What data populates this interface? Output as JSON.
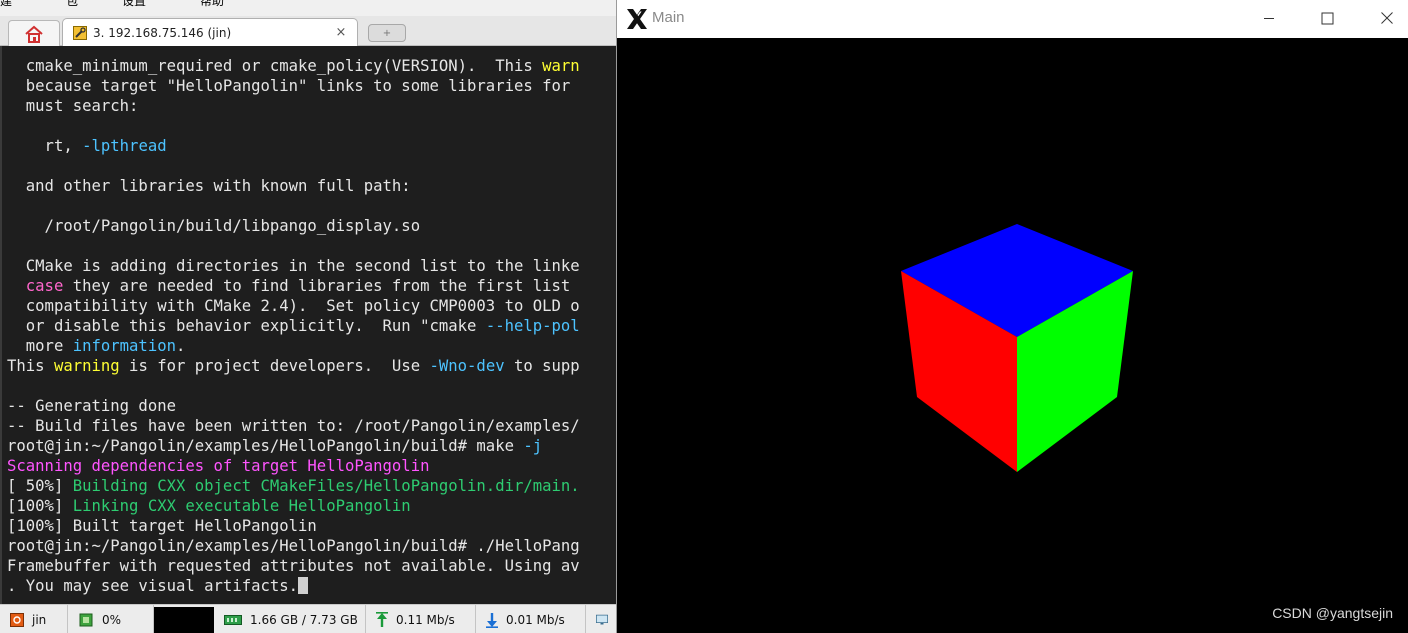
{
  "menu": {
    "items": [
      "建",
      "包",
      "设置",
      "帮助"
    ]
  },
  "tabs": {
    "home_icon": "home-icon",
    "session_title": "3. 192.168.75.146 (jin)",
    "close_glyph": "×",
    "new_tab_glyph": "+"
  },
  "terminal": {
    "lines": [
      [
        {
          "t": "  cmake_minimum_required or cmake_policy(VERSION).  This "
        },
        {
          "t": "warn",
          "c": "yel"
        }
      ],
      [
        {
          "t": "  because target \"HelloPangolin\" links to some libraries for"
        }
      ],
      [
        {
          "t": "  must search:"
        }
      ],
      [
        {
          "t": ""
        }
      ],
      [
        {
          "t": "    rt, "
        },
        {
          "t": "-lpthread",
          "c": "cyn"
        }
      ],
      [
        {
          "t": ""
        }
      ],
      [
        {
          "t": "  and other libraries with known full path:"
        }
      ],
      [
        {
          "t": ""
        }
      ],
      [
        {
          "t": "    /root/Pangolin/build/libpango_display.so"
        }
      ],
      [
        {
          "t": ""
        }
      ],
      [
        {
          "t": "  CMake is adding directories in the second list to the linke"
        }
      ],
      [
        {
          "t": "  "
        },
        {
          "t": "case",
          "c": "pnk"
        },
        {
          "t": " they are needed to find libraries from the first list"
        }
      ],
      [
        {
          "t": "  compatibility with CMake 2.4).  Set policy CMP0003 to OLD o"
        }
      ],
      [
        {
          "t": "  or disable this behavior explicitly.  Run \"cmake "
        },
        {
          "t": "--help-pol",
          "c": "cyn"
        }
      ],
      [
        {
          "t": "  more "
        },
        {
          "t": "information",
          "c": "cyn"
        },
        {
          "t": "."
        }
      ],
      [
        {
          "t": "This "
        },
        {
          "t": "warning",
          "c": "yel"
        },
        {
          "t": " is for project developers.  Use "
        },
        {
          "t": "-Wno-dev",
          "c": "cyn"
        },
        {
          "t": " to supp"
        }
      ],
      [
        {
          "t": ""
        }
      ],
      [
        {
          "t": "-- Generating done"
        }
      ],
      [
        {
          "t": "-- Build files have been written to: /root/Pangolin/examples/"
        }
      ],
      [
        {
          "t": "root@jin:~/Pangolin/examples/HelloPangolin/build# make "
        },
        {
          "t": "-j",
          "c": "cyn"
        }
      ],
      [
        {
          "t": "Scanning dependencies of target HelloPangolin",
          "c": "mag"
        }
      ],
      [
        {
          "t": "[ 50%] "
        },
        {
          "t": "Building CXX object CMakeFiles/HelloPangolin.dir/main.",
          "c": "grn"
        }
      ],
      [
        {
          "t": "[100%] "
        },
        {
          "t": "Linking CXX executable HelloPangolin",
          "c": "grn"
        }
      ],
      [
        {
          "t": "[100%] Built target HelloPangolin"
        }
      ],
      [
        {
          "t": "root@jin:~/Pangolin/examples/HelloPangolin/build# ./HelloPang"
        }
      ],
      [
        {
          "t": "Framebuffer with requested attributes not available. Using av"
        }
      ],
      [
        {
          "t": ". You may see visual artifacts."
        },
        {
          "cursor": true
        }
      ]
    ]
  },
  "status_bar": {
    "user": "jin",
    "cpu": "0%",
    "memory": "1.66 GB / 7.73 GB",
    "upload": "0.11 Mb/s",
    "download": "0.01 Mb/s"
  },
  "viewer": {
    "title": "Main",
    "app_icon": "x11-logo-icon",
    "minimize_icon": "minimize-icon",
    "maximize_icon": "maximize-icon",
    "close_icon": "close-icon",
    "cube_faces": {
      "top": "#0000ff",
      "left": "#ff0000",
      "right": "#00ff00"
    },
    "background": "#000000",
    "watermark": "CSDN @yangtsejin"
  }
}
